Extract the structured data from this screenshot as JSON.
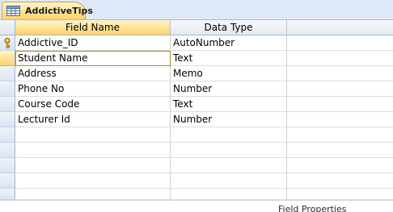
{
  "tab": {
    "title": "AddictiveTips",
    "icon": "table-icon"
  },
  "headers": {
    "field_name": "Field Name",
    "data_type": "Data Type",
    "description": ""
  },
  "rows": [
    {
      "field_name": "Addictive_ID",
      "data_type": "AutoNumber",
      "primary_key": true
    },
    {
      "field_name": "Student Name",
      "data_type": "Text",
      "selected": true
    },
    {
      "field_name": "Address",
      "data_type": "Memo"
    },
    {
      "field_name": "Phone No",
      "data_type": "Number"
    },
    {
      "field_name": "Course Code",
      "data_type": "Text"
    },
    {
      "field_name": "Lecturer Id",
      "data_type": "Number"
    }
  ],
  "footer": {
    "label": "Field Properties"
  },
  "colors": {
    "tab_active": "#ffd46a",
    "header_selected": "#ffd36b",
    "grid_line": "#d0d0d0"
  }
}
